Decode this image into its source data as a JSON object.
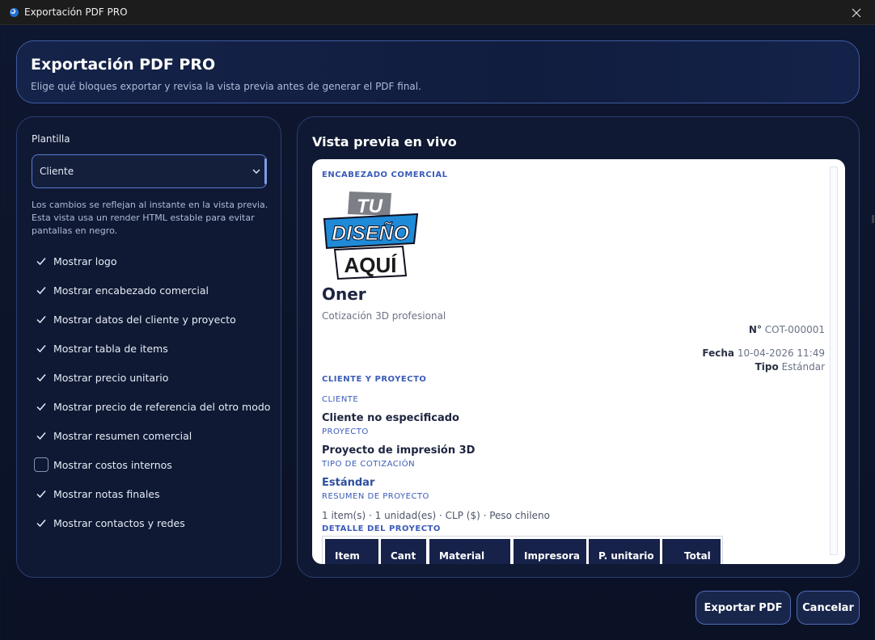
{
  "window": {
    "title": "Exportación PDF PRO"
  },
  "header": {
    "title": "Exportación PDF PRO",
    "subtitle": "Elige qué bloques exportar y revisa la vista previa antes de generar el PDF final."
  },
  "left": {
    "template_label": "Plantilla",
    "template_value": "Cliente",
    "info": "Los cambios se reflejan al instante en la vista previa. Esta vista usa un render HTML estable para evitar pantallas en negro.",
    "options": [
      {
        "label": "Mostrar logo",
        "checked": true
      },
      {
        "label": "Mostrar encabezado comercial",
        "checked": true
      },
      {
        "label": "Mostrar datos del cliente y proyecto",
        "checked": true
      },
      {
        "label": "Mostrar tabla de items",
        "checked": true
      },
      {
        "label": "Mostrar precio unitario",
        "checked": true
      },
      {
        "label": "Mostrar precio de referencia del otro modo",
        "checked": true
      },
      {
        "label": "Mostrar resumen comercial",
        "checked": true
      },
      {
        "label": "Mostrar costos internos",
        "checked": false
      },
      {
        "label": "Mostrar notas finales",
        "checked": true
      },
      {
        "label": "Mostrar contactos y redes",
        "checked": true
      }
    ]
  },
  "preview": {
    "title": "Vista previa en vivo",
    "doc": {
      "sec_header": "ENCABEZADO COMERCIAL",
      "logo": {
        "line1": "TU",
        "line2": "DISEÑO",
        "line3": "AQUÍ"
      },
      "company": "Oner",
      "tagline": "Cotización 3D profesional",
      "num_label": "N°",
      "num_value": "COT-000001",
      "fecha_label": "Fecha",
      "fecha_value": "10-04-2026 11:49",
      "tipo_label": "Tipo",
      "tipo_value": "Estándar",
      "sec_client": "CLIENTE Y PROYECTO",
      "cliente_label": "CLIENTE",
      "cliente_value": "Cliente no especificado",
      "proyecto_label": "PROYECTO",
      "proyecto_value": "Proyecto de impresión 3D",
      "tipo_cot_label": "TIPO DE COTIZACIÓN",
      "tipo_cot_value": "Estándar",
      "resumen_label": "RESUMEN DE PROYECTO",
      "resumen_value": "1 item(s) · 1 unidad(es) · CLP ($) · Peso chileno",
      "detalle_label": "DETALLE DEL PROYECTO",
      "table_headers": [
        "Item",
        "Cant",
        "Material",
        "Impresora",
        "P. unitario",
        "Total"
      ]
    }
  },
  "buttons": {
    "export": "Exportar PDF",
    "cancel": "Cancelar"
  },
  "colors": {
    "accent": "#5b7bd4",
    "panel_border": "#2c3f73",
    "doc_accent": "#3a5bb8",
    "table_header": "#17224a"
  }
}
